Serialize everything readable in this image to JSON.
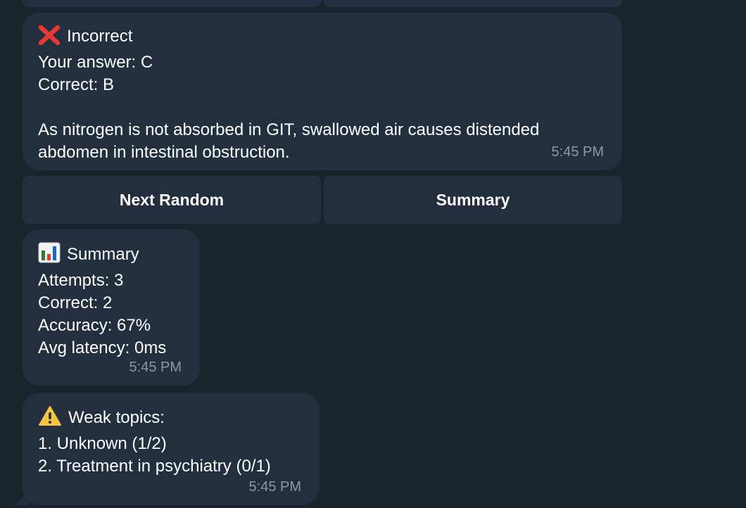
{
  "result_message": {
    "status_icon": "cross-mark-icon",
    "status_label": "Incorrect",
    "your_answer": "Your answer: C",
    "correct": "Correct: B",
    "explanation": "As nitrogen is not absorbed in GIT, swallowed air causes distended abdomen in intestinal obstruction.",
    "time": "5:45 PM"
  },
  "keyboard": {
    "next_random": "Next Random",
    "summary": "Summary"
  },
  "summary_message": {
    "icon": "bar-chart-icon",
    "title": "Summary",
    "attempts": "Attempts: 3",
    "correct": "Correct: 2",
    "accuracy": "Accuracy: 67%",
    "latency": "Avg latency: 0ms",
    "time": "5:45 PM"
  },
  "weak_message": {
    "icon": "warning-icon",
    "title": "Weak topics:",
    "topics": [
      "1. Unknown (1/2)",
      "2. Treatment in psychiatry (0/1)"
    ],
    "time": "5:45 PM"
  },
  "colors": {
    "background": "#1b232d",
    "bubble": "#232f3f",
    "timestamp": "#8b97a6",
    "incorrect": "#e53935"
  }
}
